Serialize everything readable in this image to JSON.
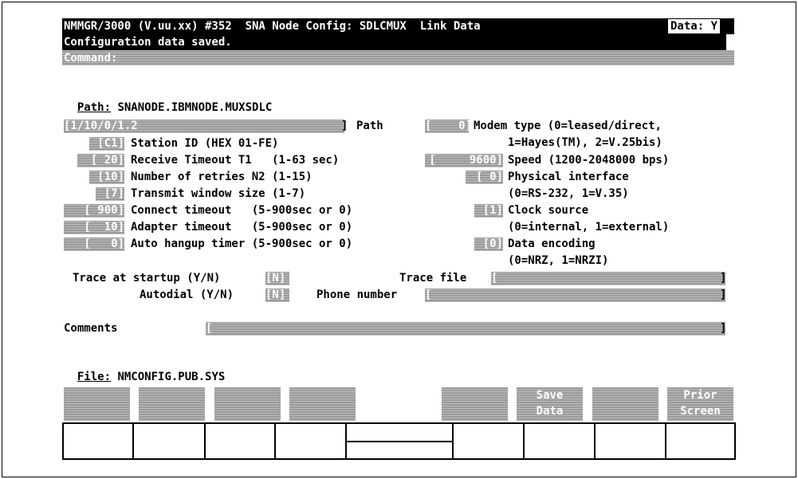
{
  "header": {
    "title": "NMMGR/3000 (V.uu.xx) #352  SNA Node Config: SDLCMUX  Link Data",
    "data_flag": "Data: Y",
    "message": "Configuration data saved.",
    "command_label": "Command:"
  },
  "path": {
    "label": "Path:",
    "value": "SNANODE.IBMNODE.MUXSDLC"
  },
  "left_fields": {
    "path_field": {
      "value": "[1/10/0/1.2",
      "close": "]",
      "label": "Path"
    },
    "station_id": {
      "value": "[C1]",
      "label": "Station ID (HEX 01-FE)"
    },
    "receive_timeout": {
      "value": "[ 20]",
      "label": "Receive Timeout T1   (1-63 sec)"
    },
    "retries": {
      "value": "[10]",
      "label": "Number of retries N2 (1-15)"
    },
    "transmit_window": {
      "value": "[7]",
      "label": "Transmit window size (1-7)"
    },
    "connect_timeout": {
      "value": "[ 900]",
      "label": "Connect timeout   (5-900sec or 0)"
    },
    "adapter_timeout": {
      "value": "[  10]",
      "label": "Adapter timeout   (5-900sec or 0)"
    },
    "auto_hangup": {
      "value": "[   0]",
      "label": "Auto hangup timer (5-900sec or 0)"
    }
  },
  "right_fields": {
    "modem_type": {
      "value": "[    0]",
      "label": "Modem type (0=leased/direct,",
      "label2": "1=Hayes(TM), 2=V.25bis)"
    },
    "speed": {
      "value": "[     9600]",
      "label": "Speed (1200-2048000 bps)"
    },
    "physical_interface": {
      "value": "[ 0]",
      "label": "Physical interface",
      "label2": "(0=RS-232, 1=V.35)"
    },
    "clock_source": {
      "value": "[1]",
      "label": "Clock source",
      "label2": "(0=internal, 1=external)"
    },
    "data_encoding": {
      "value": "[0]",
      "label": "Data encoding",
      "label2": "(0=NRZ, 1=NRZI)"
    }
  },
  "trace": {
    "trace_label": "Trace at startup (Y/N)",
    "trace_value": "[N]",
    "autodial_label": "Autodial (Y/N)",
    "autodial_value": "[N]",
    "trace_file_label": "Trace file",
    "trace_file_open": "[",
    "trace_file_close": "]",
    "phone_label": "Phone number",
    "phone_open": "[",
    "phone_close": "]"
  },
  "comments": {
    "label": "Comments",
    "open": "[",
    "close": "]"
  },
  "file": {
    "label": "File:",
    "value": "NMCONFIG.PUB.SYS"
  },
  "function_keys": [
    {
      "label1": "",
      "label2": ""
    },
    {
      "label1": "",
      "label2": ""
    },
    {
      "label1": "",
      "label2": ""
    },
    {
      "label1": "",
      "label2": ""
    },
    {
      "label1": "",
      "label2": ""
    },
    {
      "label1": "Save",
      "label2": "Data"
    },
    {
      "label1": "",
      "label2": ""
    },
    {
      "label1": "Prior",
      "label2": "Screen"
    }
  ]
}
